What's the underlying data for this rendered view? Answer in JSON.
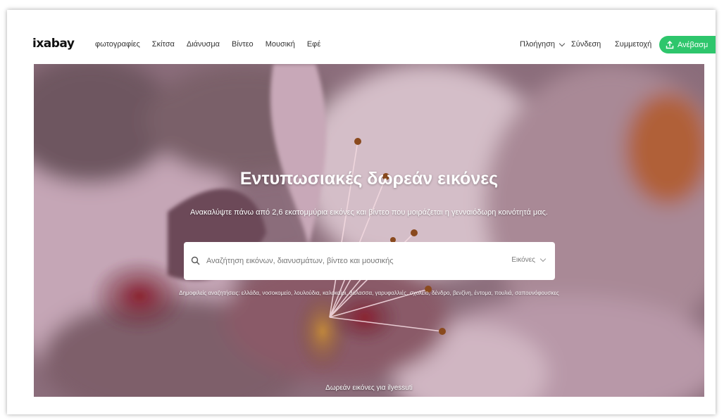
{
  "header": {
    "logo": "ixabay",
    "nav": [
      "φωτογραφίες",
      "Σκίτσα",
      "Διάνυσμα",
      "Βίντεο",
      "Μουσική",
      "Εφέ"
    ],
    "explore": "Πλοήγηση",
    "login": "Σύνδεση",
    "join": "Συμμετοχή",
    "upload": "Ανέβασμ"
  },
  "hero": {
    "title": "Εντυπωσιακές δωρεάν εικόνες",
    "subtitle": "Ανακαλύψτε πάνω από 2,6 εκατομμύρια εικόνες και βίντεο που μοιράζεται η γενναιόδωρη κοινότητά μας.",
    "search_placeholder": "Αναζήτηση εικόνων, διανυσμάτων, βίντεο και μουσικής",
    "search_type": "Εικόνες",
    "popular": "Δημοφιλείς αναζητήσεις: ελλάδα, νοσοκομείο, λουλούδια, καλοκαίρι, θάλασσα, γαρυφαλλιές, σχολείο, δένδρο, βενζίνη, έντομα, πουλιά, σαπουνόφουσκες",
    "credit": "Δωρεάν εικόνες για ilyessuti"
  },
  "colors": {
    "accent": "#2ec66c",
    "hero_base": "#8b6876"
  }
}
